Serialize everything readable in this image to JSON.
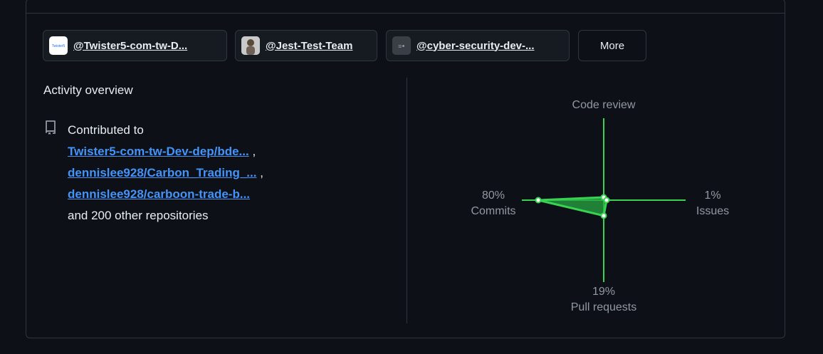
{
  "orgs": [
    {
      "name": "@Twister5-com-tw-D...",
      "avatar_text": "Twister5"
    },
    {
      "name": "@Jest-Test-Team"
    },
    {
      "name": "@cyber-security-dev-..."
    }
  ],
  "more_label": "More",
  "activity": {
    "title": "Activity overview",
    "contributed_prefix": "Contributed to",
    "repos": [
      "Twister5-com-tw-Dev-dep/bde...",
      "dennislee928/Carbon_Trading_...",
      "dennislee928/carboon-trade-b..."
    ],
    "separator": ",",
    "other_text": "and 200 other repositories"
  },
  "chart_data": {
    "type": "radar",
    "axes": [
      {
        "key": "code_review",
        "label": "Code review",
        "value": 0,
        "value_label": ""
      },
      {
        "key": "issues",
        "label": "Issues",
        "value": 1,
        "value_label": "1%"
      },
      {
        "key": "pull_requests",
        "label": "Pull requests",
        "value": 19,
        "value_label": "19%"
      },
      {
        "key": "commits",
        "label": "Commits",
        "value": 80,
        "value_label": "80%"
      }
    ],
    "colors": {
      "axis": "#39d353",
      "fill": "#26a641",
      "point": "#ffffff"
    }
  }
}
